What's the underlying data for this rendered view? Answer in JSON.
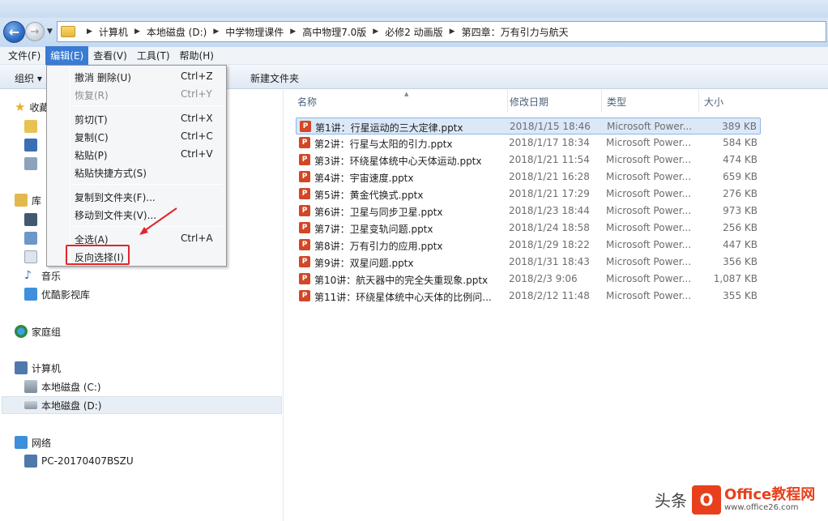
{
  "nav": {
    "breadcrumbs": [
      "计算机",
      "本地磁盘 (D:)",
      "中学物理课件",
      "高中物理7.0版",
      "必修2 动画版",
      "第四章：万有引力与航天"
    ]
  },
  "menubar": [
    "文件(F)",
    "编辑(E)",
    "查看(V)",
    "工具(T)",
    "帮助(H)"
  ],
  "toolbar": {
    "organize": "组织 ▾",
    "new_folder": "新建文件夹"
  },
  "edit_menu": {
    "items": [
      {
        "label": "撤消 删除(U)",
        "shortcut": "Ctrl+Z",
        "disabled": false
      },
      {
        "label": "恢复(R)",
        "shortcut": "Ctrl+Y",
        "disabled": true
      },
      {
        "label": "剪切(T)",
        "shortcut": "Ctrl+X",
        "disabled": false
      },
      {
        "label": "复制(C)",
        "shortcut": "Ctrl+C",
        "disabled": false
      },
      {
        "label": "粘贴(P)",
        "shortcut": "Ctrl+V",
        "disabled": false
      },
      {
        "label": "粘贴快捷方式(S)",
        "shortcut": "",
        "disabled": false
      },
      {
        "label": "复制到文件夹(F)...",
        "shortcut": "",
        "disabled": false
      },
      {
        "label": "移动到文件夹(V)...",
        "shortcut": "",
        "disabled": false
      },
      {
        "label": "全选(A)",
        "shortcut": "Ctrl+A",
        "disabled": false
      },
      {
        "label": "反向选择(I)",
        "shortcut": "",
        "disabled": false
      }
    ]
  },
  "sidebar": {
    "favorites": "收藏",
    "libraries": "库",
    "music": "音乐",
    "youku": "优酷影视库",
    "homegroup": "家庭组",
    "computer": "计算机",
    "drive_c": "本地磁盘 (C:)",
    "drive_d": "本地磁盘 (D:)",
    "network": "网络",
    "pc": "PC-20170407BSZU"
  },
  "columns": {
    "name": "名称",
    "date": "修改日期",
    "type": "类型",
    "size": "大小"
  },
  "files": [
    {
      "name": "第1讲：行星运动的三大定律.pptx",
      "date": "2018/1/15 18:46",
      "type": "Microsoft Power...",
      "size": "389 KB"
    },
    {
      "name": "第2讲：行星与太阳的引力.pptx",
      "date": "2018/1/17 18:34",
      "type": "Microsoft Power...",
      "size": "584 KB"
    },
    {
      "name": "第3讲：环绕星体统中心天体运动.pptx",
      "date": "2018/1/21 11:54",
      "type": "Microsoft Power...",
      "size": "474 KB"
    },
    {
      "name": "第4讲：宇宙速度.pptx",
      "date": "2018/1/21 16:28",
      "type": "Microsoft Power...",
      "size": "659 KB"
    },
    {
      "name": "第5讲：黄金代换式.pptx",
      "date": "2018/1/21 17:29",
      "type": "Microsoft Power...",
      "size": "276 KB"
    },
    {
      "name": "第6讲：卫星与同步卫星.pptx",
      "date": "2018/1/23 18:44",
      "type": "Microsoft Power...",
      "size": "973 KB"
    },
    {
      "name": "第7讲：卫星变轨问题.pptx",
      "date": "2018/1/24 18:58",
      "type": "Microsoft Power...",
      "size": "256 KB"
    },
    {
      "name": "第8讲：万有引力的应用.pptx",
      "date": "2018/1/29 18:22",
      "type": "Microsoft Power...",
      "size": "447 KB"
    },
    {
      "name": "第9讲：双星问题.pptx",
      "date": "2018/1/31 18:43",
      "type": "Microsoft Power...",
      "size": "356 KB"
    },
    {
      "name": "第10讲：航天器中的完全失重现象.pptx",
      "date": "2018/2/3 9:06",
      "type": "Microsoft Power...",
      "size": "1,087 KB"
    },
    {
      "name": "第11讲：环绕星体统中心天体的比例问...",
      "date": "2018/2/12 11:48",
      "type": "Microsoft Power...",
      "size": "355 KB"
    }
  ],
  "watermark": {
    "toutiao": "头条",
    "brand": "Office教程网",
    "url": "www.office26.com"
  }
}
